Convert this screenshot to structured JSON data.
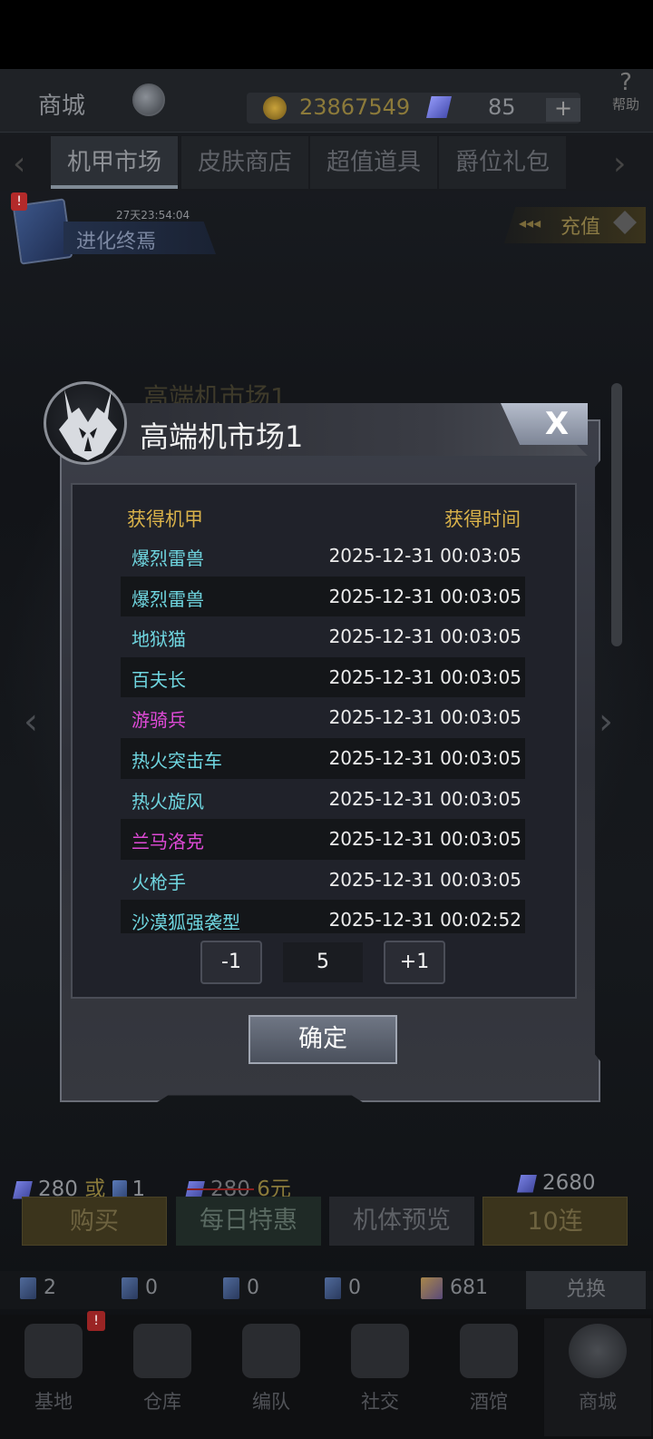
{
  "header": {
    "shop_title": "商城",
    "coins": "23867549",
    "gems": "85",
    "plus": "+",
    "help_label": "帮助",
    "help_symbol": "?"
  },
  "tabs": [
    {
      "label": "机甲市场",
      "active": true
    },
    {
      "label": "皮肤商店",
      "active": false
    },
    {
      "label": "超值道具",
      "active": false
    },
    {
      "label": "爵位礼包",
      "active": false
    }
  ],
  "event": {
    "timer": "27天23:54:04",
    "name": "进化终焉",
    "alert": "!",
    "recharge_label": "充值"
  },
  "background_title": "高端机市场1",
  "modal": {
    "title": "高端机市场1",
    "close_label": "X",
    "col_mecha": "获得机甲",
    "col_time": "获得时间",
    "rows": [
      {
        "mecha": "爆烈雷兽",
        "time": "2025-12-31 00:03:05",
        "color": "cyan"
      },
      {
        "mecha": "爆烈雷兽",
        "time": "2025-12-31 00:03:05",
        "color": "cyan"
      },
      {
        "mecha": "地狱猫",
        "time": "2025-12-31 00:03:05",
        "color": "cyan"
      },
      {
        "mecha": "百夫长",
        "time": "2025-12-31 00:03:05",
        "color": "cyan"
      },
      {
        "mecha": "游骑兵",
        "time": "2025-12-31 00:03:05",
        "color": "purple"
      },
      {
        "mecha": "热火突击车",
        "time": "2025-12-31 00:03:05",
        "color": "cyan"
      },
      {
        "mecha": "热火旋风",
        "time": "2025-12-31 00:03:05",
        "color": "cyan"
      },
      {
        "mecha": "兰马洛克",
        "time": "2025-12-31 00:03:05",
        "color": "purple"
      },
      {
        "mecha": "火枪手",
        "time": "2025-12-31 00:03:05",
        "color": "cyan"
      },
      {
        "mecha": "沙漠狐强袭型",
        "time": "2025-12-31 00:02:52",
        "color": "cyan"
      }
    ],
    "decrement": "-1",
    "quantity": "5",
    "increment": "+1",
    "confirm": "确定"
  },
  "purchase": {
    "single_gem_price": "280",
    "or_text": "或",
    "single_card_price": "1",
    "original_price": "280",
    "discount_price": "6元",
    "ten_price": "2680",
    "buttons": [
      "购买",
      "每日特惠",
      "机体预览",
      "10连"
    ]
  },
  "inventory": {
    "items": [
      "2",
      "0",
      "0",
      "0",
      "681"
    ],
    "exchange": "兑换"
  },
  "nav": {
    "items": [
      "基地",
      "仓库",
      "编队",
      "社交",
      "酒馆",
      "商城"
    ],
    "active": "商城",
    "alert": "!"
  },
  "colors": {
    "cyan_text": "#6fd6e0",
    "purple_text": "#e04ad8",
    "header_gold": "#d9b24a"
  }
}
